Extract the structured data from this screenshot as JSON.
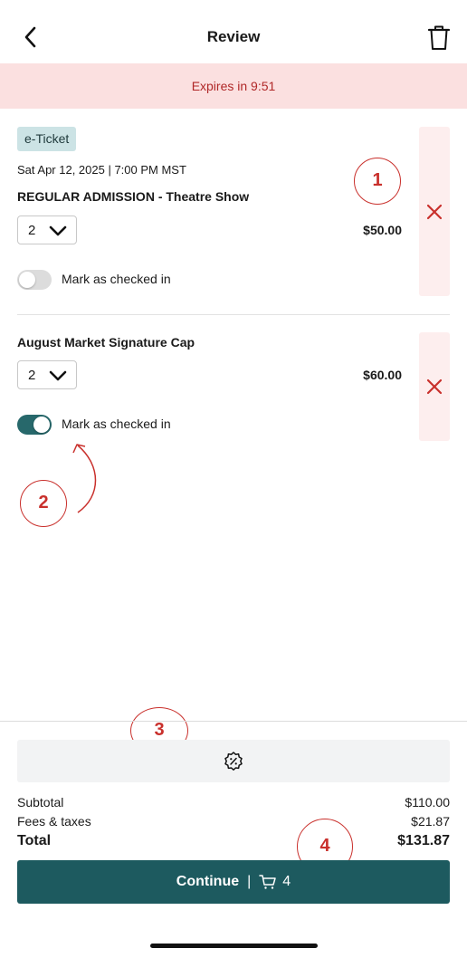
{
  "header": {
    "title": "Review",
    "back_icon": "chevron-left-icon",
    "trash_icon": "trash-icon"
  },
  "expiry": {
    "text": "Expires in 9:51",
    "color": "#b02828",
    "background": "#fbe0e0"
  },
  "items": [
    {
      "badge": "e-Ticket",
      "date": "Sat Apr 12, 2025  |  7:00 PM MST",
      "name": "REGULAR ADMISSION - Theatre Show",
      "quantity": "2",
      "price": "$50.00",
      "checkin_label": "Mark as checked in",
      "checked_in": false
    },
    {
      "name": "August Market Signature Cap",
      "quantity": "2",
      "price": "$60.00",
      "checkin_label": "Mark as checked in",
      "checked_in": true
    }
  ],
  "annotations": [
    "1",
    "2",
    "3",
    "4"
  ],
  "promo": {
    "icon": "discount-badge-icon"
  },
  "summary": {
    "subtotal_label": "Subtotal",
    "subtotal_value": "$110.00",
    "fees_label": "Fees & taxes",
    "fees_value": "$21.87",
    "total_label": "Total",
    "total_value": "$131.87"
  },
  "continue": {
    "label": "Continue",
    "separator": "|",
    "cart_count": "4",
    "cart_icon": "cart-icon"
  },
  "colors": {
    "accent": "#1d5a5f",
    "toggle_on": "#27686b",
    "remove": "#c9302c",
    "annotation": "#c9302c"
  }
}
